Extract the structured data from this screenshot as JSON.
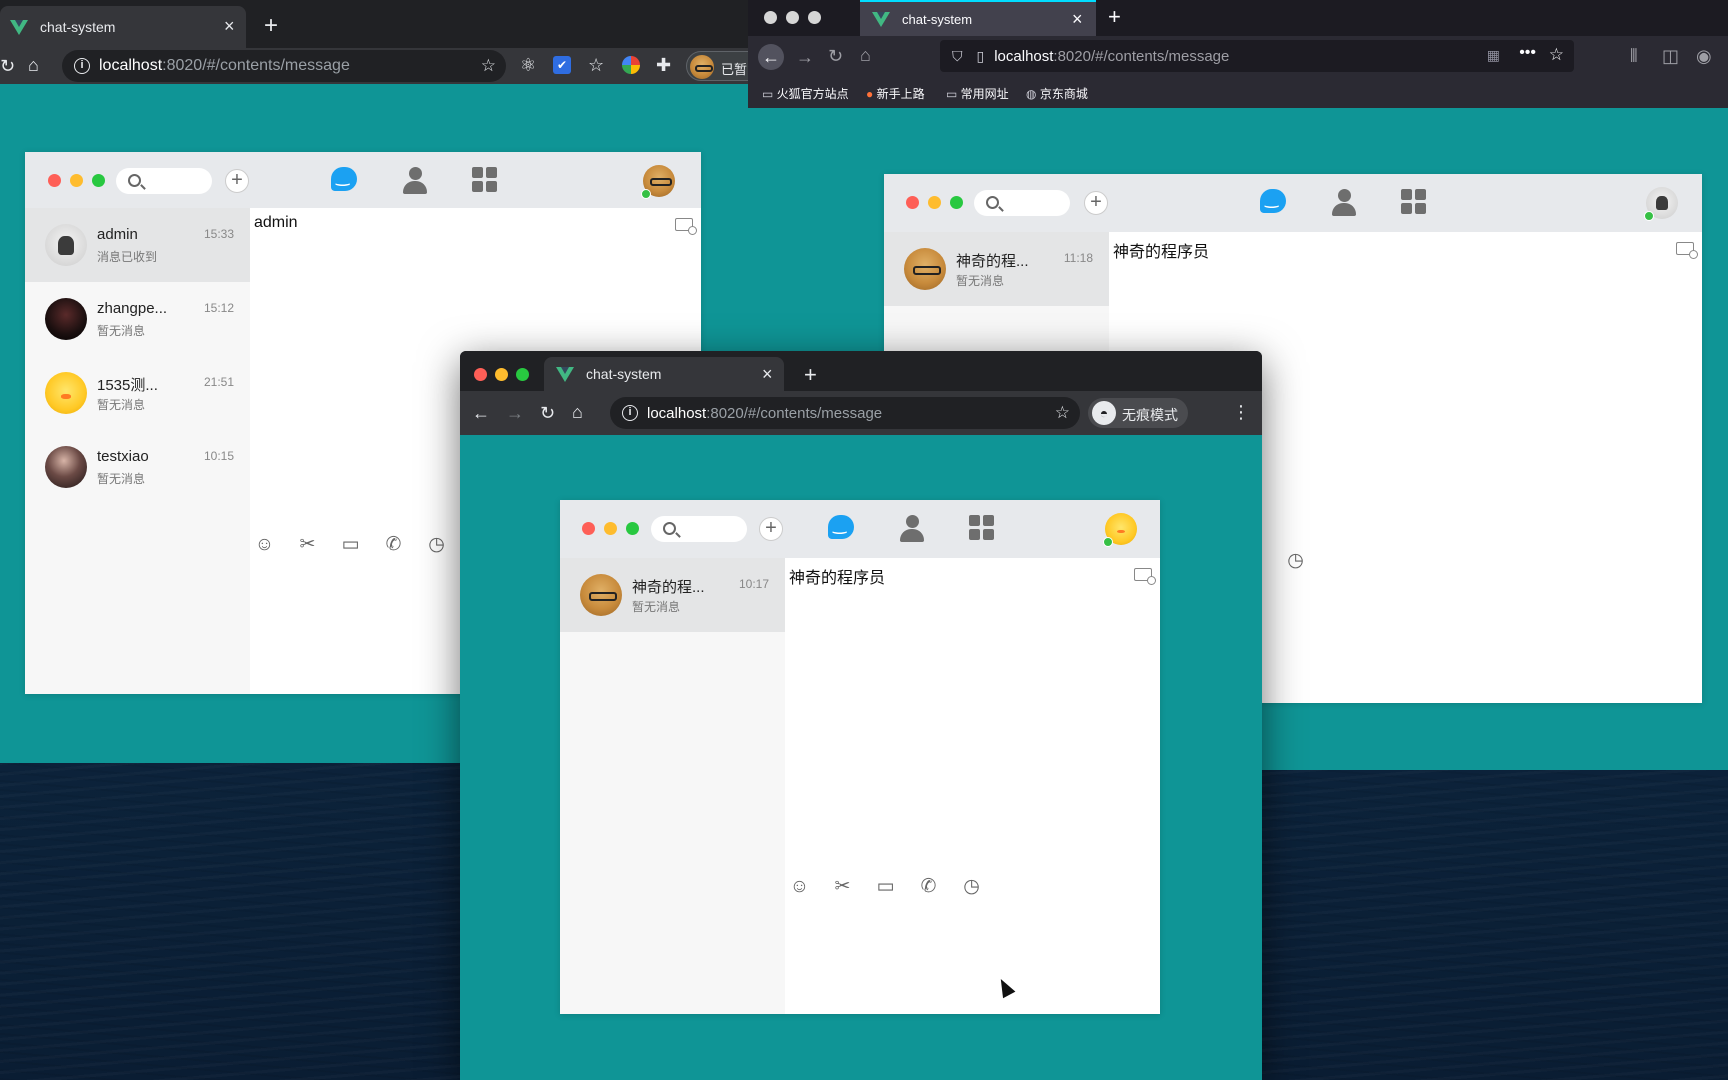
{
  "left_browser": {
    "tab_title": "chat-system",
    "url_host": "localhost",
    "url_rest": ":8020/#/contents/message",
    "profile_label": "已暂",
    "chat": {
      "conversation_title": "admin",
      "contacts": [
        {
          "name": "admin",
          "time": "15:33",
          "last": "消息已收到"
        },
        {
          "name": "zhangpe...",
          "time": "15:12",
          "last": "暂无消息"
        },
        {
          "name": "1535测...",
          "time": "21:51",
          "last": "暂无消息"
        },
        {
          "name": "testxiao",
          "time": "10:15",
          "last": "暂无消息"
        }
      ]
    }
  },
  "right_browser": {
    "tab_title": "chat-system",
    "url_host": "localhost",
    "url_rest": ":8020/#/contents/message",
    "bookmarks": [
      "火狐官方站点",
      "新手上路",
      "常用网址",
      "京东商城"
    ],
    "chat": {
      "conversation_title": "神奇的程序员",
      "contacts": [
        {
          "name": "神奇的程...",
          "time": "11:18",
          "last": "暂无消息"
        }
      ]
    }
  },
  "front_browser": {
    "tab_title": "chat-system",
    "url_host": "localhost",
    "url_rest": ":8020/#/contents/message",
    "incognito_label": "无痕模式",
    "chat": {
      "conversation_title": "神奇的程序员",
      "contacts": [
        {
          "name": "神奇的程...",
          "time": "10:17",
          "last": "暂无消息"
        }
      ]
    }
  },
  "colors": {
    "desktop_bg": "#0f9596",
    "chrome_dark": "#202124",
    "chrome_light": "#dee1e6",
    "firefox_dark": "#1c1b22",
    "accent_blue": "#1ba1f2",
    "online_green": "#36c045",
    "traffic_red": "#fe5f57",
    "traffic_yellow": "#febc2e",
    "traffic_green": "#28c840"
  },
  "icons": {
    "tools": [
      "emoji-icon",
      "scissors-icon",
      "folder-icon",
      "phone-icon",
      "history-icon"
    ],
    "nav": [
      "chat-bubble-icon",
      "contacts-icon",
      "apps-grid-icon"
    ]
  }
}
